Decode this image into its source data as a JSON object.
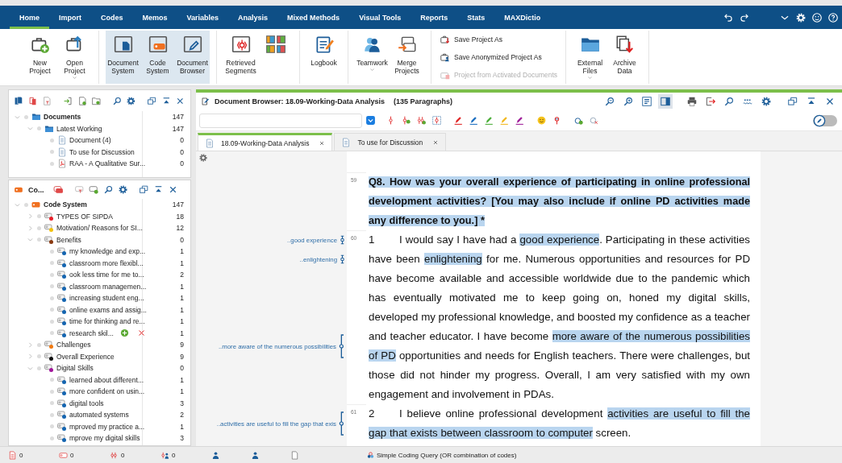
{
  "menu": [
    {
      "label": "Home",
      "selected": true
    },
    {
      "label": "Import",
      "selected": false
    },
    {
      "label": "Codes",
      "selected": false
    },
    {
      "label": "Memos",
      "selected": false
    },
    {
      "label": "Variables",
      "selected": false
    },
    {
      "label": "Analysis",
      "selected": false
    },
    {
      "label": "Mixed Methods",
      "selected": false
    },
    {
      "label": "Visual Tools",
      "selected": false
    },
    {
      "label": "Reports",
      "selected": false
    },
    {
      "label": "Stats",
      "selected": false
    },
    {
      "label": "MAXDictio",
      "selected": false
    }
  ],
  "ribbon": [
    {
      "kind": "large",
      "items": [
        {
          "label": "New Project",
          "on": false,
          "dropdown": false
        },
        {
          "label": "Open Project",
          "on": false,
          "dropdown": true
        }
      ]
    },
    {
      "kind": "large",
      "items": [
        {
          "label": "Document System",
          "on": true,
          "dropdown": false
        },
        {
          "label": "Code System",
          "on": true,
          "dropdown": false
        },
        {
          "label": "Document Browser",
          "on": true,
          "dropdown": false
        }
      ]
    },
    {
      "kind": "large",
      "items": [
        {
          "label": "Retrieved Segments",
          "on": false,
          "dropdown": false
        },
        {
          "on": false,
          "dropdown": false
        }
      ]
    },
    {
      "kind": "large",
      "items": [
        {
          "label": "Logbook",
          "on": false,
          "dropdown": false
        }
      ]
    },
    {
      "kind": "large",
      "items": [
        {
          "label": "Teamwork",
          "on": false,
          "dropdown": true
        },
        {
          "label": "Merge Projects",
          "on": false,
          "dropdown": false
        }
      ]
    },
    {
      "kind": "small",
      "items": [
        {
          "label": "Save Project As",
          "disabled": false
        },
        {
          "label": "Save Anonymized Project As",
          "disabled": false
        },
        {
          "label": "Project from Activated Documents",
          "disabled": true
        }
      ]
    },
    {
      "kind": "large",
      "items": [
        {
          "label": "External Files",
          "on": false,
          "dropdown": true
        },
        {
          "label": "Archive Data",
          "on": false,
          "dropdown": false
        }
      ]
    }
  ],
  "document_tree": [
    {
      "label": "Documents",
      "kind": "folder",
      "count": "147",
      "expanded": true,
      "children": [
        {
          "label": "Latest Working",
          "kind": "folder",
          "count": "147",
          "expanded": true,
          "children": [
            {
              "label": "Document (4)",
              "kind": "text",
              "count": "0"
            },
            {
              "label": "To use for Discussion",
              "kind": "text",
              "count": "0"
            },
            {
              "label": "RAA - A Qualitative Sur...",
              "kind": "pdf",
              "count": "0"
            }
          ]
        }
      ]
    }
  ],
  "code_panel_title": "Co...",
  "code_tree": [
    {
      "label": "Code System",
      "kind": "root",
      "count": "147",
      "expanded": true,
      "children": [
        {
          "label": "TYPES OF SIPDA",
          "kind": "code",
          "color": "#e8202a",
          "count": "18",
          "expanded": false
        },
        {
          "label": "Motivation/ Reasons for SI...",
          "kind": "code",
          "color": "#f2c20f",
          "count": "12",
          "expanded": false
        },
        {
          "label": "Benefits",
          "kind": "code",
          "color": "#8a3b12",
          "count": "0",
          "expanded": true,
          "children": [
            {
              "label": "my knowledge and exp...",
              "kind": "code",
              "color": "#1565b0",
              "count": "1"
            },
            {
              "label": "classroom more flexibl...",
              "kind": "code",
              "color": "#1565b0",
              "count": "1"
            },
            {
              "label": "ook less time for me to...",
              "kind": "code",
              "color": "#1565b0",
              "count": "2"
            },
            {
              "label": "classroom managemen...",
              "kind": "code",
              "color": "#1565b0",
              "count": "1"
            },
            {
              "label": "increasing student eng...",
              "kind": "code",
              "color": "#1565b0",
              "count": "1"
            },
            {
              "label": "online exams and assig...",
              "kind": "code",
              "color": "#1565b0",
              "count": "1"
            },
            {
              "label": "time for thinking and re...",
              "kind": "code",
              "color": "#1565b0",
              "count": "1"
            },
            {
              "label": "research skil...",
              "kind": "code",
              "color": "#1565b0",
              "count": "1",
              "hover_actions": true
            }
          ]
        },
        {
          "label": "Challenges",
          "kind": "code",
          "color": "#f07a12",
          "count": "9",
          "expanded": false
        },
        {
          "label": "Overall Experience",
          "kind": "code",
          "color": "#111111",
          "count": "9",
          "expanded": false
        },
        {
          "label": "Digital Skills",
          "kind": "code",
          "color": "#a0159a",
          "count": "0",
          "expanded": true,
          "children": [
            {
              "label": "learned about different...",
              "kind": "code",
              "color": "#1565b0",
              "count": "1"
            },
            {
              "label": "more confident on usin...",
              "kind": "code",
              "color": "#1565b0",
              "count": "1"
            },
            {
              "label": "digital tools",
              "kind": "code",
              "color": "#1565b0",
              "count": "3"
            },
            {
              "label": "automated systems",
              "kind": "code",
              "color": "#1565b0",
              "count": "2"
            },
            {
              "label": "mproved my practice a...",
              "kind": "code",
              "color": "#1565b0",
              "count": "1"
            },
            {
              "label": "mprove my digital skills",
              "kind": "code",
              "color": "#1565b0",
              "count": "3"
            }
          ]
        }
      ]
    }
  ],
  "browser": {
    "title": "Document Browser: 18.09-Working-Data Analysis",
    "paragraph_count": "(135 Paragraphs)",
    "edit_mode": {
      "on": false
    },
    "tabs": [
      {
        "label": "18.09-Working-Data Analysis",
        "selected": true
      },
      {
        "label": "To use for Discussion",
        "selected": false
      }
    ],
    "paragraphs": [
      {
        "number": "59",
        "bold": true,
        "segments": [
          {
            "text": "Q8. How was your overall experience of participating in online professional development activities? [You may also include if online PD activities made any difference to you.] *",
            "coded": true
          }
        ]
      },
      {
        "number": "60",
        "bold": false,
        "label": "1",
        "segments": [
          {
            "text": "I would say I have had a ",
            "coded": false
          },
          {
            "text": "good experience",
            "coded": true
          },
          {
            "text": ". Participating in these activities have been ",
            "coded": false
          },
          {
            "text": "enlightening",
            "coded": true
          },
          {
            "text": " for me. Numerous opportunities and resources for PD have become available and accessible worldwide due to the pandemic which has eventually motivated me to keep going on, honed my digital skills, developed my professional knowledge, and boosted my confidence as a teacher and teacher educator. I have become ",
            "coded": false
          },
          {
            "text": "more aware of the numerous possibilities of PD",
            "coded": true
          },
          {
            "text": " opportunities and needs for English teachers. There were challenges, but those did not hinder my progress. Overall, I am very satisfied with my own engagement and involvement in PDAs.",
            "coded": false
          }
        ],
        "codes": [
          {
            "text": "..good experience",
            "kind": "inline"
          },
          {
            "text": "..enlightening",
            "kind": "inline"
          },
          {
            "text": "..more aware of the numerous possibilities",
            "kind": "bracket"
          }
        ]
      },
      {
        "number": "61",
        "bold": false,
        "label": "2",
        "segments": [
          {
            "text": "I believe online professional development ",
            "coded": false
          },
          {
            "text": "activities are useful to fill the gap that exists between classroom to computer",
            "coded": true
          },
          {
            "text": " screen.",
            "coded": false
          }
        ],
        "codes": [
          {
            "text": "..activities are useful to fill the gap that exis",
            "kind": "bracket"
          }
        ]
      }
    ]
  },
  "status_bar": {
    "counts": [
      "0",
      "0",
      "0",
      "0"
    ],
    "query": "Simple Coding Query (OR combination of codes)"
  }
}
